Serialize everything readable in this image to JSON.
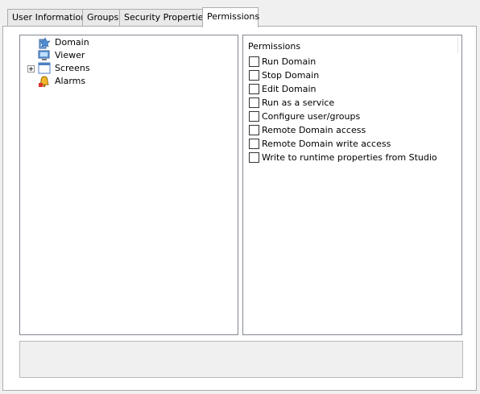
{
  "tabs": [
    {
      "label": "User Information",
      "active": false
    },
    {
      "label": "Groups",
      "active": false
    },
    {
      "label": "Security Properties",
      "active": false
    },
    {
      "label": "Permissions",
      "active": true
    }
  ],
  "tree": {
    "items": [
      {
        "label": "Domain",
        "icon": "domain-icon",
        "expandable": false
      },
      {
        "label": "Viewer",
        "icon": "viewer-icon",
        "expandable": false
      },
      {
        "label": "Screens",
        "icon": "screens-icon",
        "expandable": true
      },
      {
        "label": "Alarms",
        "icon": "alarms-icon",
        "expandable": false
      }
    ]
  },
  "permissions": {
    "title": "Permissions",
    "items": [
      {
        "label": "Run Domain",
        "checked": false
      },
      {
        "label": "Stop Domain",
        "checked": false
      },
      {
        "label": "Edit Domain",
        "checked": false
      },
      {
        "label": "Run as a service",
        "checked": false
      },
      {
        "label": "Configure user/groups",
        "checked": false
      },
      {
        "label": "Remote Domain access",
        "checked": false
      },
      {
        "label": "Remote Domain write access",
        "checked": false
      },
      {
        "label": "Write to runtime properties from Studio",
        "checked": false
      }
    ]
  },
  "colors": {
    "window_bg": "#f0f0f0",
    "panel_bg": "#ffffff",
    "border": "#828790"
  }
}
